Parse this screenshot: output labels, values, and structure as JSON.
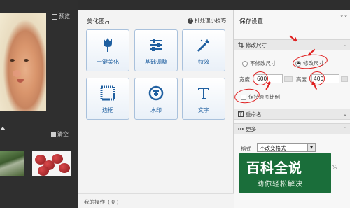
{
  "left_panel": {
    "preview_label": "预览",
    "clear_label": "清空",
    "preview_icon": "preview-icon",
    "clear_icon": "trash-icon"
  },
  "middle_panel": {
    "title": "美化图片",
    "tips_label": "批处理小技巧",
    "tools": [
      {
        "label": "一键美化",
        "icon": "tulip-icon"
      },
      {
        "label": "基础调整",
        "icon": "sliders-icon"
      },
      {
        "label": "特效",
        "icon": "magic-wand-icon"
      },
      {
        "label": "边框",
        "icon": "frame-icon"
      },
      {
        "label": "水印",
        "icon": "watermark-stamp-icon"
      },
      {
        "label": "文字",
        "icon": "text-T-icon"
      }
    ],
    "history_label": "我的操作",
    "history_count": "( 0 )"
  },
  "right_panel": {
    "title": "保存设置",
    "collapse_glyph": "⌄⌄",
    "sections": {
      "resize": "修改尺寸",
      "rename": "重命名",
      "more": "更多"
    },
    "resize_options": {
      "no_resize": "不修改尺寸",
      "resize": "修改尺寸",
      "selected": "resize"
    },
    "width_label": "宽度",
    "width_value": "600",
    "height_label": "高度",
    "height_value": "400",
    "keep_ratio_label": "保持原图比例",
    "keep_ratio_checked": false,
    "format_label": "格式",
    "format_value": "不改变格式",
    "quality_label": "画",
    "quality_pct": "%"
  },
  "watermark": {
    "title": "百科全说",
    "subtitle": "助你轻松解决"
  },
  "colors": {
    "accent_blue": "#1f5fa0",
    "annotation_red": "#e02020",
    "watermark_green": "#1a6e3a"
  }
}
